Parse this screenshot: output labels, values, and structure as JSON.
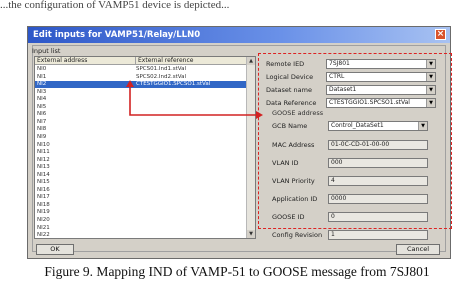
{
  "top_text": "...the configuration of VAMP51 device is depicted...",
  "window": {
    "title": "Edit inputs for VAMP51/Relay/LLN0"
  },
  "input_list": {
    "label": "Input list",
    "columns": [
      "External address",
      "External reference"
    ],
    "rows": [
      {
        "addr": "NI0",
        "ref": "SPCS01.Ind1.stVal"
      },
      {
        "addr": "NI1",
        "ref": "SPCS02.Ind2.stVal"
      },
      {
        "addr": "NI2",
        "ref": "CTESTGGIO1.SPCSO1.stVal",
        "selected": true
      },
      {
        "addr": "NI3",
        "ref": ""
      },
      {
        "addr": "NI4",
        "ref": ""
      },
      {
        "addr": "NI5",
        "ref": ""
      },
      {
        "addr": "NI6",
        "ref": ""
      },
      {
        "addr": "NI7",
        "ref": ""
      },
      {
        "addr": "NI8",
        "ref": ""
      },
      {
        "addr": "NI9",
        "ref": ""
      },
      {
        "addr": "NI10",
        "ref": ""
      },
      {
        "addr": "NI11",
        "ref": ""
      },
      {
        "addr": "NI12",
        "ref": ""
      },
      {
        "addr": "NI13",
        "ref": ""
      },
      {
        "addr": "NI14",
        "ref": ""
      },
      {
        "addr": "NI15",
        "ref": ""
      },
      {
        "addr": "NI16",
        "ref": ""
      },
      {
        "addr": "NI17",
        "ref": ""
      },
      {
        "addr": "NI18",
        "ref": ""
      },
      {
        "addr": "NI19",
        "ref": ""
      },
      {
        "addr": "NI20",
        "ref": ""
      },
      {
        "addr": "NI21",
        "ref": ""
      },
      {
        "addr": "NI22",
        "ref": ""
      }
    ]
  },
  "form": {
    "remote_ied": {
      "label": "Remote IED",
      "value": "7SJ801"
    },
    "logical_device": {
      "label": "Logical Device",
      "value": "CTRL"
    },
    "dataset_name": {
      "label": "Dataset name",
      "value": "Dataset1"
    },
    "data_reference": {
      "label": "Data Reference",
      "value": "CTESTGGIO1.SPCSO1.stVal"
    },
    "goose_address_heading": "GOOSE address",
    "gcb_name": {
      "label": "GCB Name",
      "value": "Control_DataSet1"
    },
    "mac_address": {
      "label": "MAC Address",
      "value": "01-0C-CD-01-00-00"
    },
    "vlan_id": {
      "label": "VLAN ID",
      "value": "000"
    },
    "vlan_priority": {
      "label": "VLAN Priority",
      "value": "4"
    },
    "application_id": {
      "label": "Application ID",
      "value": "0000"
    },
    "goose_id": {
      "label": "GOOSE ID",
      "value": "0"
    },
    "config_revision": {
      "label": "Config Revision",
      "value": "1"
    }
  },
  "buttons": {
    "ok": "OK",
    "cancel": "Cancel"
  },
  "caption": "Figure 9. Mapping IND of VAMP-51 to GOOSE message from 7SJ801",
  "colors": {
    "highlight": "#d22222",
    "selection": "#3167c6",
    "titlebar": "#2d57c8"
  }
}
